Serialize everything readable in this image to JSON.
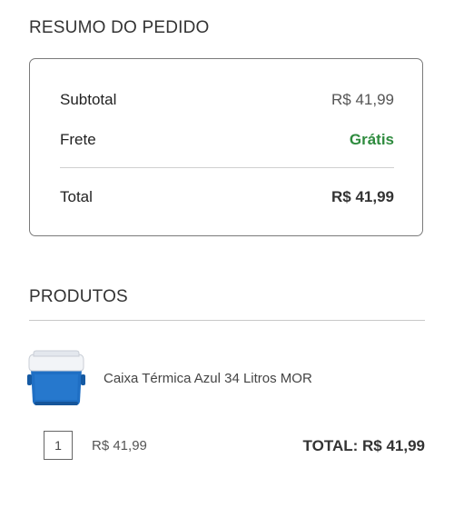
{
  "order_summary": {
    "title": "RESUMO DO PEDIDO",
    "subtotal_label": "Subtotal",
    "subtotal_value": "R$ 41,99",
    "shipping_label": "Frete",
    "shipping_value": "Grátis",
    "total_label": "Total",
    "total_value": "R$ 41,99",
    "shipping_color": "#2e8b3e"
  },
  "products": {
    "title": "PRODUTOS",
    "items": [
      {
        "name": "Caixa Térmica Azul 34 Litros MOR",
        "image_icon": "cooler-box-product-image",
        "quantity": "1",
        "unit_price": "R$ 41,99",
        "line_total": "TOTAL: R$ 41,99",
        "image_colors": {
          "body": "#1f6fc4",
          "lid": "#f2f4f7"
        }
      }
    ]
  }
}
